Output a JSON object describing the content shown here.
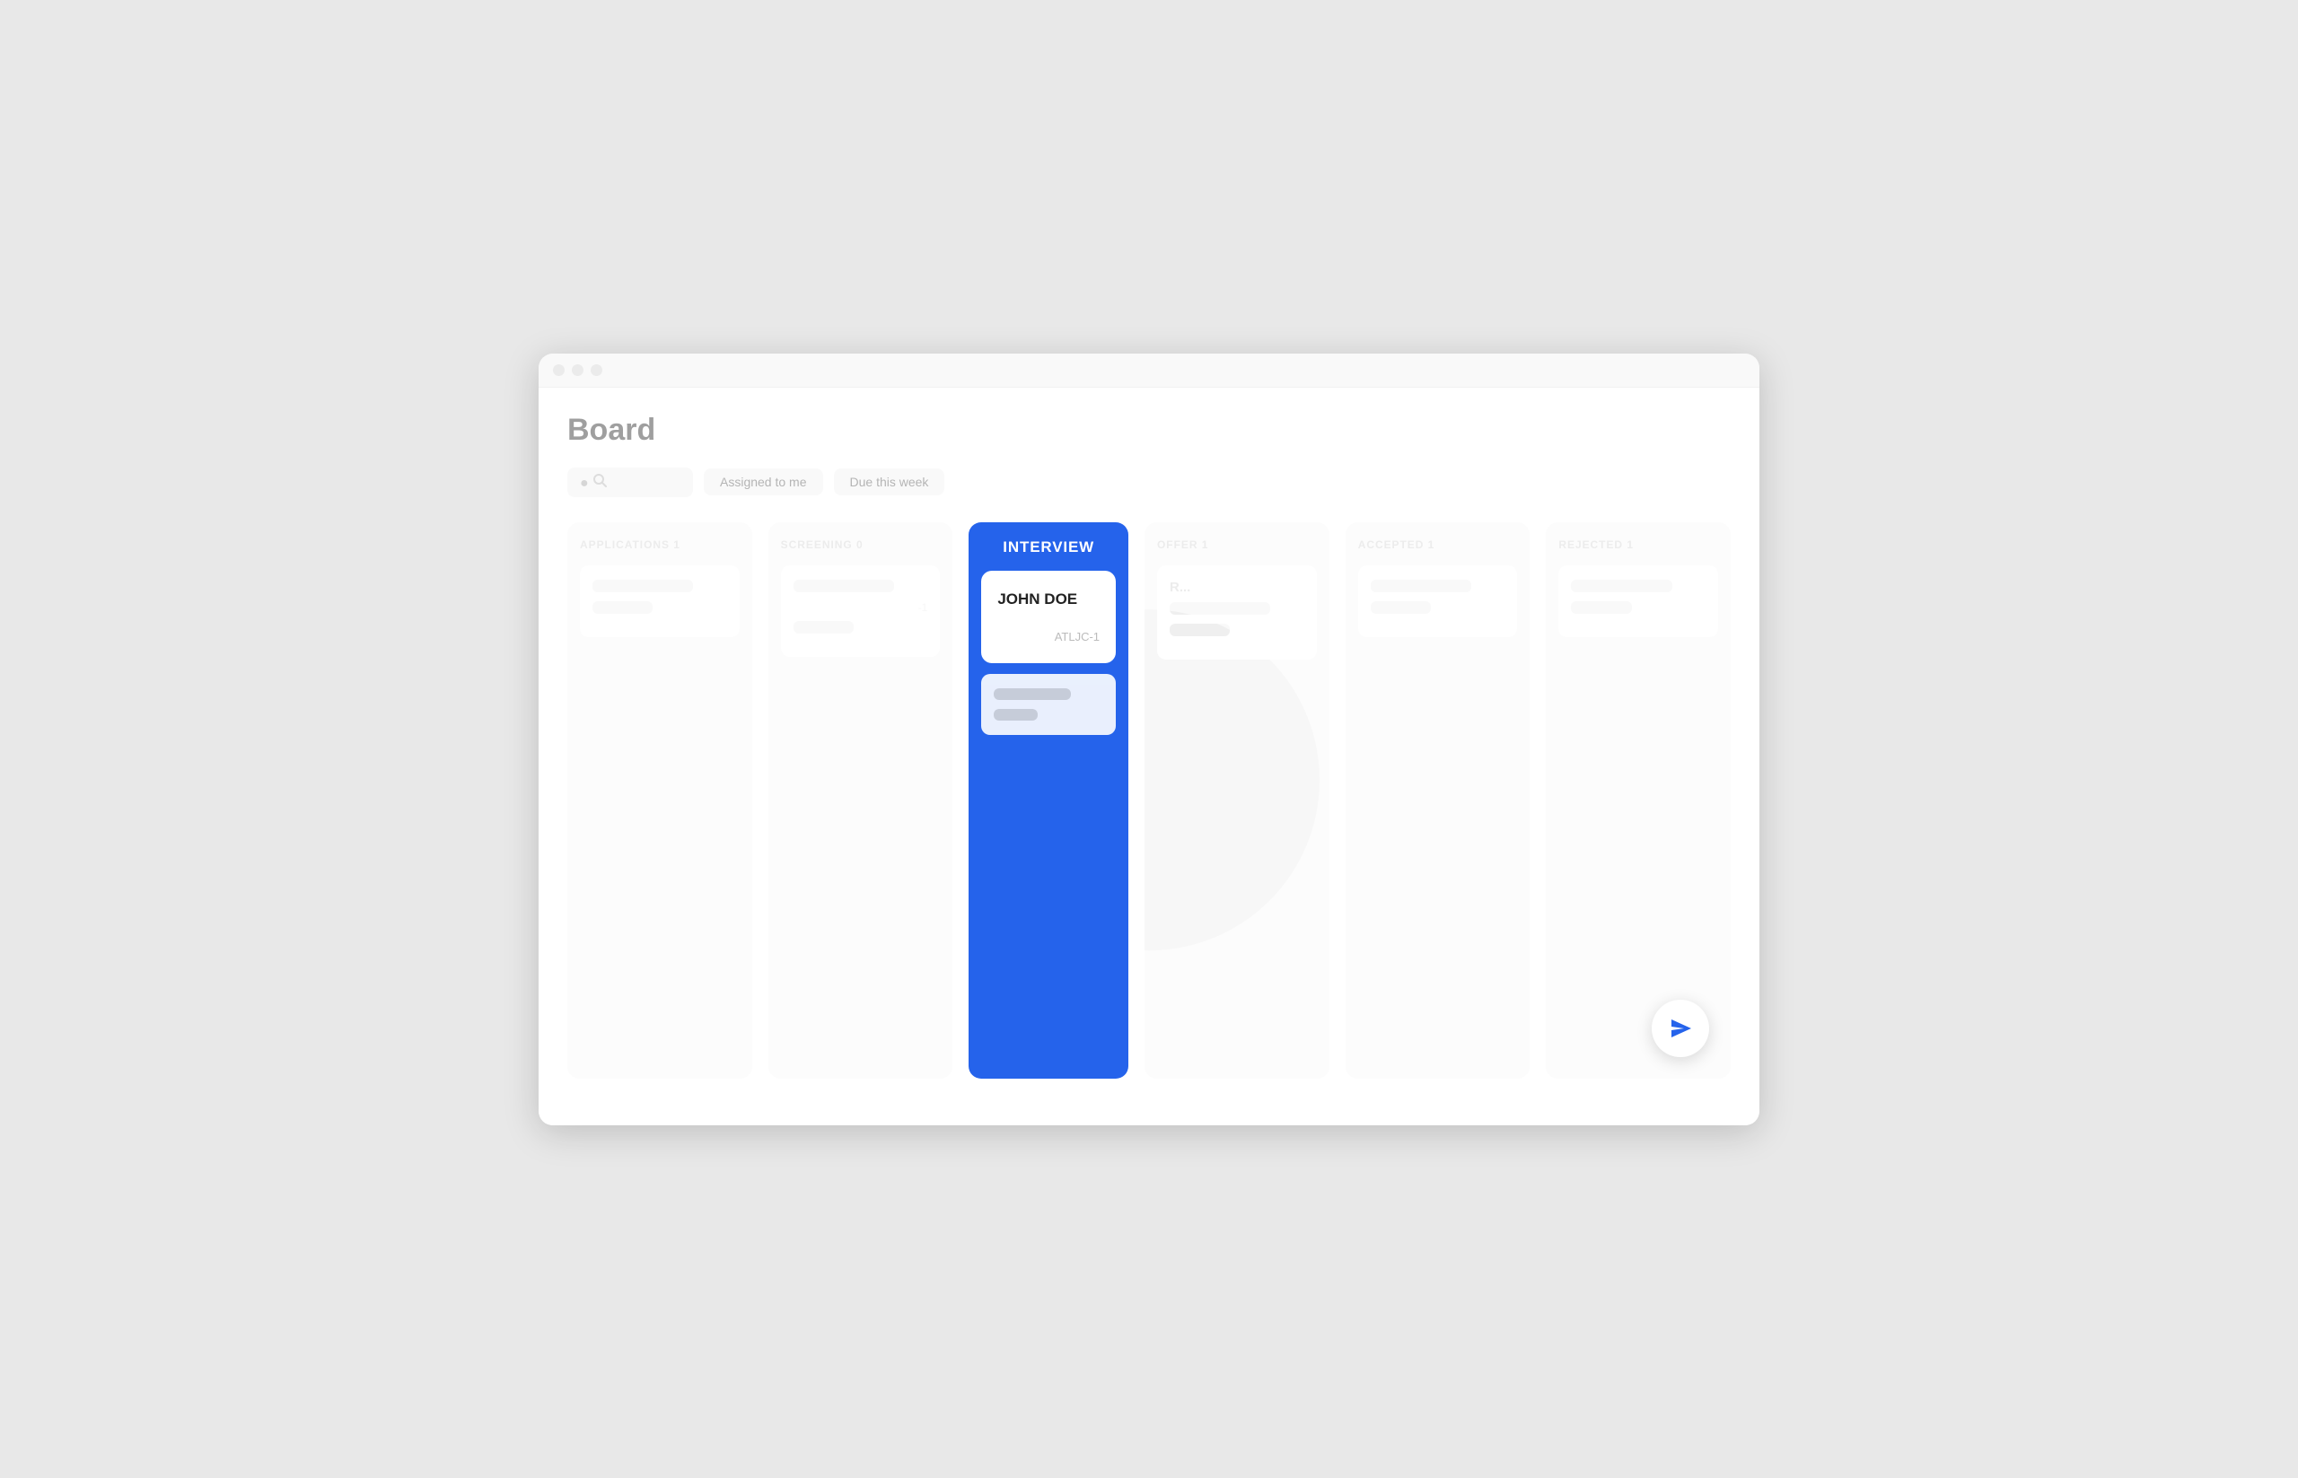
{
  "window": {
    "title": "Board"
  },
  "header": {
    "title": "Board"
  },
  "toolbar": {
    "search_placeholder": "",
    "filter1": "Assigned to me",
    "filter2": "Due this week"
  },
  "board": {
    "columns": [
      {
        "id": "applications",
        "label": "APPLICATIONS 1"
      },
      {
        "id": "screening",
        "label": "SCREENING 0"
      },
      {
        "id": "interview",
        "label": "INTERVIEW"
      },
      {
        "id": "offer",
        "label": "OFFER 1"
      },
      {
        "id": "accepted",
        "label": "ACCEPTED 1"
      },
      {
        "id": "rejected",
        "label": "REJECTED 1"
      }
    ],
    "highlight_column": "interview",
    "active_card": {
      "name": "JOHN DOE",
      "id": "ATLJC-1"
    }
  },
  "fab": {
    "label": "Send",
    "color": "#2563EB"
  }
}
